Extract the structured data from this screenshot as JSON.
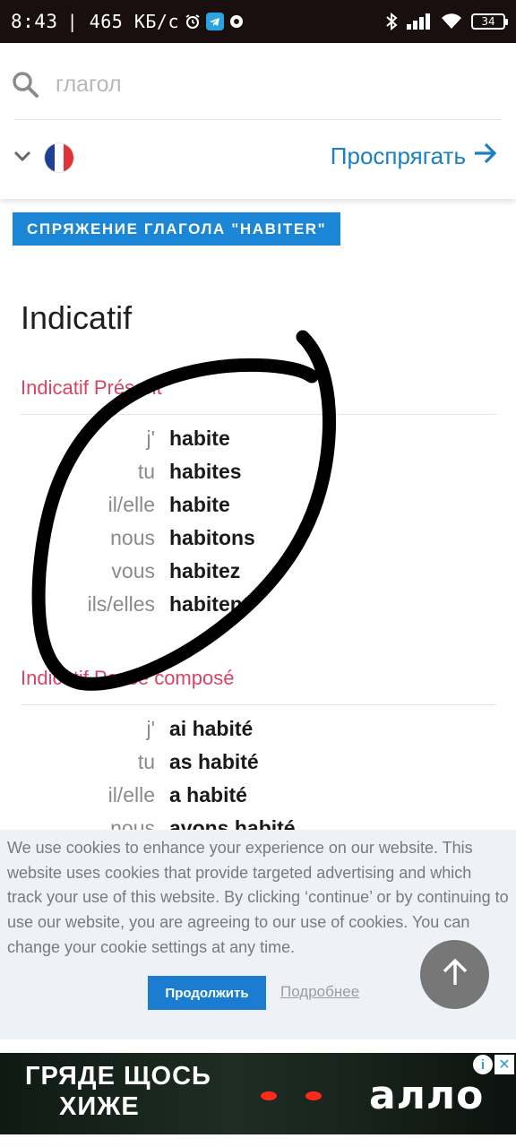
{
  "status_bar": {
    "time": "8:43",
    "speed": "| 465 КБ/с",
    "battery": "34",
    "icons": [
      "alarm-icon",
      "telegram-icon",
      "app-dot-icon",
      "bluetooth-icon",
      "signal-icon",
      "wifi-icon",
      "battery-icon"
    ]
  },
  "search": {
    "placeholder": "глагол",
    "value": ""
  },
  "language": {
    "flag": "france-flag-icon",
    "flag_colors": [
      "#1f3f95",
      "#ffffff",
      "#e1323c"
    ]
  },
  "conjugate_button": {
    "label": "Проспрягать",
    "color": "#1b7fc4"
  },
  "page": {
    "badge": "СПРЯЖЕНИЕ ГЛАГОЛА \"HABITER\"",
    "mood_title": "Indicatif",
    "tenses": [
      {
        "title": "Indicatif Présent",
        "rows": [
          {
            "pronoun": "j'",
            "form": "habite"
          },
          {
            "pronoun": "tu",
            "form": "habites"
          },
          {
            "pronoun": "il/elle",
            "form": "habite"
          },
          {
            "pronoun": "nous",
            "form": "habitons"
          },
          {
            "pronoun": "vous",
            "form": "habitez"
          },
          {
            "pronoun": "ils/elles",
            "form": "habitent"
          }
        ]
      },
      {
        "title": "Indicatif Passé composé",
        "rows": [
          {
            "pronoun": "j'",
            "form": "ai habité"
          },
          {
            "pronoun": "tu",
            "form": "as habité"
          },
          {
            "pronoun": "il/elle",
            "form": "a habité"
          },
          {
            "pronoun": "nous",
            "form": "avons habité"
          }
        ]
      }
    ]
  },
  "cookie_banner": {
    "text": "We use cookies to enhance your experience on our website. This website uses cookies that provide targeted advertising and which track your use of this website. By clicking ‘continue’ or by continuing to use our website, you are agreeing to our use of cookies. You can change your cookie settings at any time.",
    "continue_label": "Продолжить",
    "more_label": "Подробнее"
  },
  "ad": {
    "line1": "ГРЯДЕ ЩОСЬ",
    "line2": "ХИЖЕ",
    "brand": "алло",
    "info": "i",
    "close": "✕"
  },
  "colors": {
    "accent_blue": "#1b86d6",
    "tense_pink": "#d64566",
    "cookie_bg": "#eef2f6"
  }
}
